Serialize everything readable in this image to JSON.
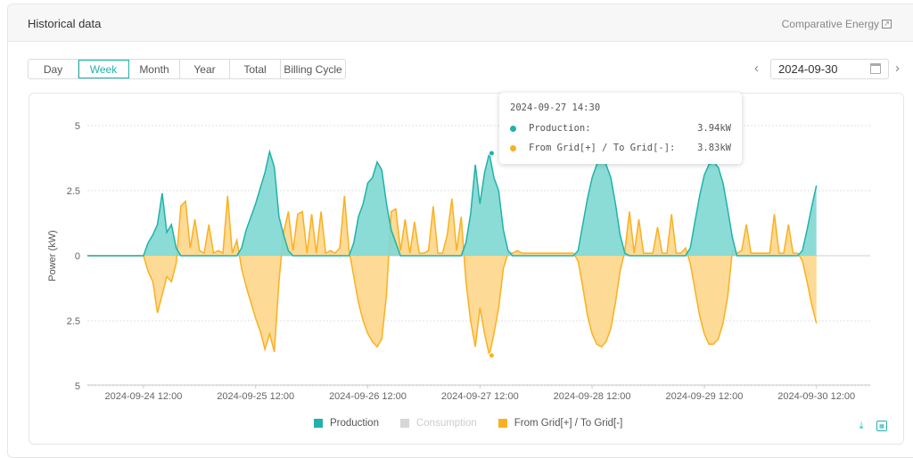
{
  "header": {
    "title": "Historical data",
    "comparative_label": "Comparative Energy"
  },
  "tabs": [
    {
      "label": "Day",
      "w": 56
    },
    {
      "label": "Week",
      "w": 57,
      "active": true
    },
    {
      "label": "Month",
      "w": 57
    },
    {
      "label": "Year",
      "w": 56
    },
    {
      "label": "Total",
      "w": 57
    },
    {
      "label": "Billing Cycle",
      "w": 72
    }
  ],
  "date_picker": {
    "value": "2024-09-30"
  },
  "colors": {
    "production": "#20b2aa",
    "production_fill": "#7ed8d2",
    "grid": "#f9b122",
    "grid_fill": "#fdd68a",
    "consumption": "#d6d6d6",
    "accent": "#20b2aa"
  },
  "tooltip": {
    "time": "2024-09-27 14:30",
    "rows": [
      {
        "label": "Production:",
        "value": "3.94kW",
        "color": "#20b2aa"
      },
      {
        "label": "From Grid[+] / To Grid[-]:",
        "value": "3.83kW",
        "color": "#f9b122"
      }
    ]
  },
  "legend": [
    {
      "label": "Production",
      "color": "#20b2aa"
    },
    {
      "label": "Consumption",
      "color": "#d6d6d6",
      "disabled": true
    },
    {
      "label": "From Grid[+] / To Grid[-]",
      "color": "#f9b122"
    }
  ],
  "chart_data": {
    "type": "area",
    "ylabel": "Power (kW)",
    "ylim": [
      -5,
      5
    ],
    "yticks": [
      5,
      2.5,
      0,
      -2.5,
      -5
    ],
    "ytick_labels": [
      "5",
      "2.5",
      "0",
      "2.5",
      "5"
    ],
    "x_start": "2024-09-24 00:00",
    "x_end": "2024-09-30 23:00",
    "x_step": "1 hour",
    "xtick_labels": [
      "2024-09-24 12:00",
      "2024-09-25 12:00",
      "2024-09-26 12:00",
      "2024-09-27 12:00",
      "2024-09-28 12:00",
      "2024-09-29 12:00",
      "2024-09-30 12:00"
    ],
    "grid": true,
    "legend_position": "bottom",
    "series": [
      {
        "name": "Production",
        "values": [
          0,
          0,
          0,
          0,
          0,
          0,
          0,
          0,
          0,
          0,
          0,
          0,
          0,
          0.5,
          0.8,
          1.2,
          2.4,
          0.9,
          1.2,
          0.3,
          0,
          0,
          0,
          0,
          0,
          0,
          0,
          0,
          0,
          0,
          0,
          0,
          0,
          0.3,
          1.0,
          1.5,
          2.0,
          2.6,
          3.2,
          4.0,
          3.4,
          1.5,
          0.8,
          0.2,
          0,
          0,
          0,
          0,
          0,
          0,
          0,
          0,
          0,
          0,
          0,
          0,
          0,
          0.5,
          1.5,
          2.0,
          2.8,
          3.0,
          3.6,
          3.3,
          2.0,
          1.0,
          0.5,
          0,
          0,
          0,
          0,
          0,
          0,
          0,
          0,
          0,
          0,
          0,
          0,
          0,
          0,
          0.5,
          1.6,
          3.5,
          2.0,
          3.2,
          3.94,
          3.0,
          2.5,
          1.0,
          0.2,
          0,
          0,
          0,
          0,
          0,
          0,
          0,
          0,
          0,
          0,
          0,
          0,
          0,
          0,
          0.2,
          1.2,
          2.2,
          3.0,
          3.5,
          3.7,
          3.5,
          3.0,
          2.0,
          0.8,
          0.1,
          0,
          0,
          0,
          0,
          0,
          0,
          0,
          0,
          0,
          0,
          0,
          0,
          0,
          0.3,
          1.3,
          2.3,
          3.1,
          3.5,
          3.6,
          3.4,
          2.8,
          1.8,
          0.7,
          0,
          0,
          0,
          0,
          0,
          0,
          0,
          0,
          0,
          0,
          0,
          0,
          0,
          0,
          0.2,
          1.0,
          1.9,
          2.7
        ]
      },
      {
        "name": "Consumption",
        "values": []
      },
      {
        "name": "From Grid[+] / To Grid[-]",
        "values": [
          0,
          0,
          0,
          0,
          0,
          0,
          0,
          0,
          0,
          0,
          0,
          0,
          0,
          -0.6,
          -1.0,
          -2.2,
          -1.5,
          -0.8,
          -1.0,
          -0.3,
          1.9,
          2.1,
          0.3,
          1.4,
          0.2,
          0.1,
          1.2,
          0.1,
          0.2,
          0.1,
          2.3,
          0.1,
          0.6,
          -0.5,
          -1.2,
          -1.8,
          -2.4,
          -2.9,
          -3.6,
          -3.0,
          -3.7,
          -1.0,
          0.9,
          1.7,
          0.2,
          1.6,
          1.7,
          0.1,
          1.6,
          0.1,
          1.7,
          0.1,
          0.2,
          0.1,
          0.3,
          2.3,
          0.2,
          -0.8,
          -1.8,
          -2.5,
          -3.0,
          -3.3,
          -3.5,
          -3.2,
          -1.5,
          1.7,
          1.8,
          0.2,
          1.4,
          0.1,
          1.3,
          0.1,
          0.1,
          0.2,
          1.9,
          0.1,
          0.1,
          0.8,
          2.2,
          0.2,
          1.5,
          -1.0,
          -2.5,
          -3.5,
          -2.0,
          -3.0,
          -3.83,
          -3.0,
          -2.0,
          -0.5,
          0.1,
          0.1,
          0.2,
          0.1,
          0.1,
          0.1,
          0.1,
          0.1,
          0.1,
          0.1,
          0.1,
          0.1,
          0.1,
          0.1,
          0.1,
          -0.2,
          -1.2,
          -2.3,
          -3.0,
          -3.4,
          -3.5,
          -3.3,
          -2.8,
          -1.8,
          -0.6,
          0.2,
          1.7,
          0.1,
          1.4,
          0.1,
          0.1,
          0.1,
          1.1,
          0.1,
          0.1,
          1.6,
          0.1,
          0.1,
          0.3,
          -0.3,
          -1.3,
          -2.3,
          -3.0,
          -3.4,
          -3.4,
          -3.2,
          -2.6,
          -1.6,
          0.2,
          0.1,
          0.2,
          1.2,
          0.1,
          0.1,
          0.1,
          0.1,
          0.1,
          1.6,
          0.1,
          0.1,
          1.2,
          0.1,
          0.1,
          -0.2,
          -1.0,
          -1.9,
          -2.6
        ]
      }
    ]
  }
}
